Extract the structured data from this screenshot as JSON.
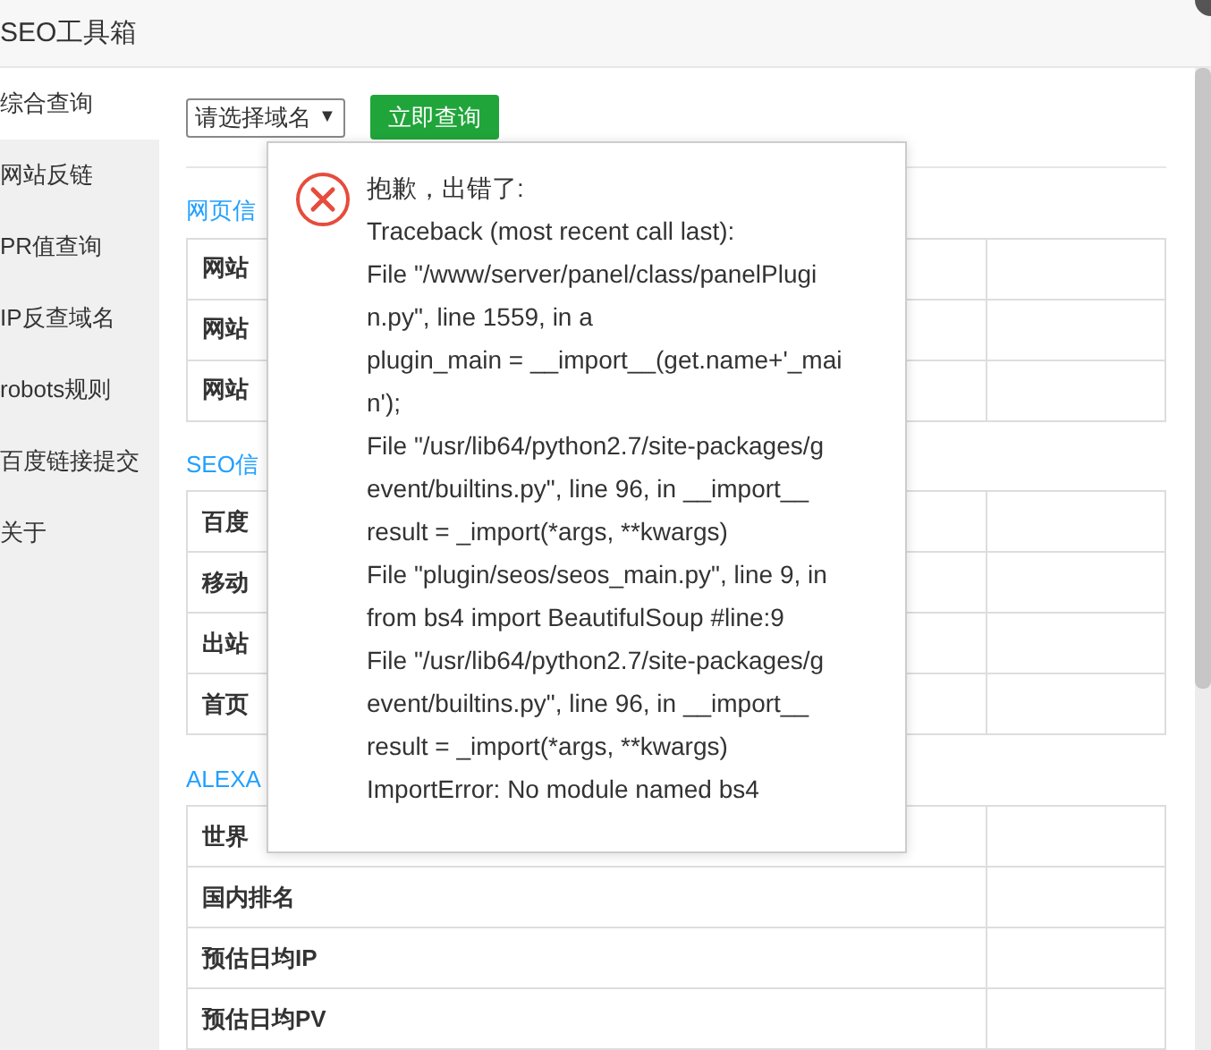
{
  "window": {
    "title": "SEO工具箱"
  },
  "sidebar": {
    "items": [
      {
        "label": "综合查询",
        "selected": true
      },
      {
        "label": "网站反链",
        "selected": false
      },
      {
        "label": "PR值查询",
        "selected": false
      },
      {
        "label": "IP反查域名",
        "selected": false
      },
      {
        "label": "robots规则",
        "selected": false
      },
      {
        "label": "百度链接提交",
        "selected": false
      },
      {
        "label": "关于",
        "selected": false
      }
    ]
  },
  "toolbar": {
    "domain_select": {
      "value": "请选择域名",
      "arrow": "▼"
    },
    "query_button": "立即查询"
  },
  "sections": [
    {
      "title": "网页信",
      "rows": [
        "网站",
        "网站",
        "网站"
      ]
    },
    {
      "title": "SEO信",
      "rows": [
        "百度",
        "移动",
        "出站",
        "首页"
      ]
    },
    {
      "title": "ALEXA",
      "rows": [
        "世界",
        "国内排名",
        "预估日均IP",
        "预估日均PV"
      ]
    }
  ],
  "error_dialog": {
    "lines": [
      "抱歉，出错了:",
      "Traceback (most recent call last):",
      "File \"/www/server/panel/class/panelPlugi",
      "n.py\", line 1559, in a",
      "plugin_main = __import__(get.name+'_mai",
      "n');",
      "File \"/usr/lib64/python2.7/site-packages/g",
      "event/builtins.py\", line 96, in __import__",
      "result = _import(*args, **kwargs)",
      "File \"plugin/seos/seos_main.py\", line 9, in",
      "from bs4 import BeautifulSoup #line:9",
      "File \"/usr/lib64/python2.7/site-packages/g",
      "event/builtins.py\", line 96, in __import__",
      "result = _import(*args, **kwargs)",
      "ImportError: No module named bs4"
    ]
  }
}
